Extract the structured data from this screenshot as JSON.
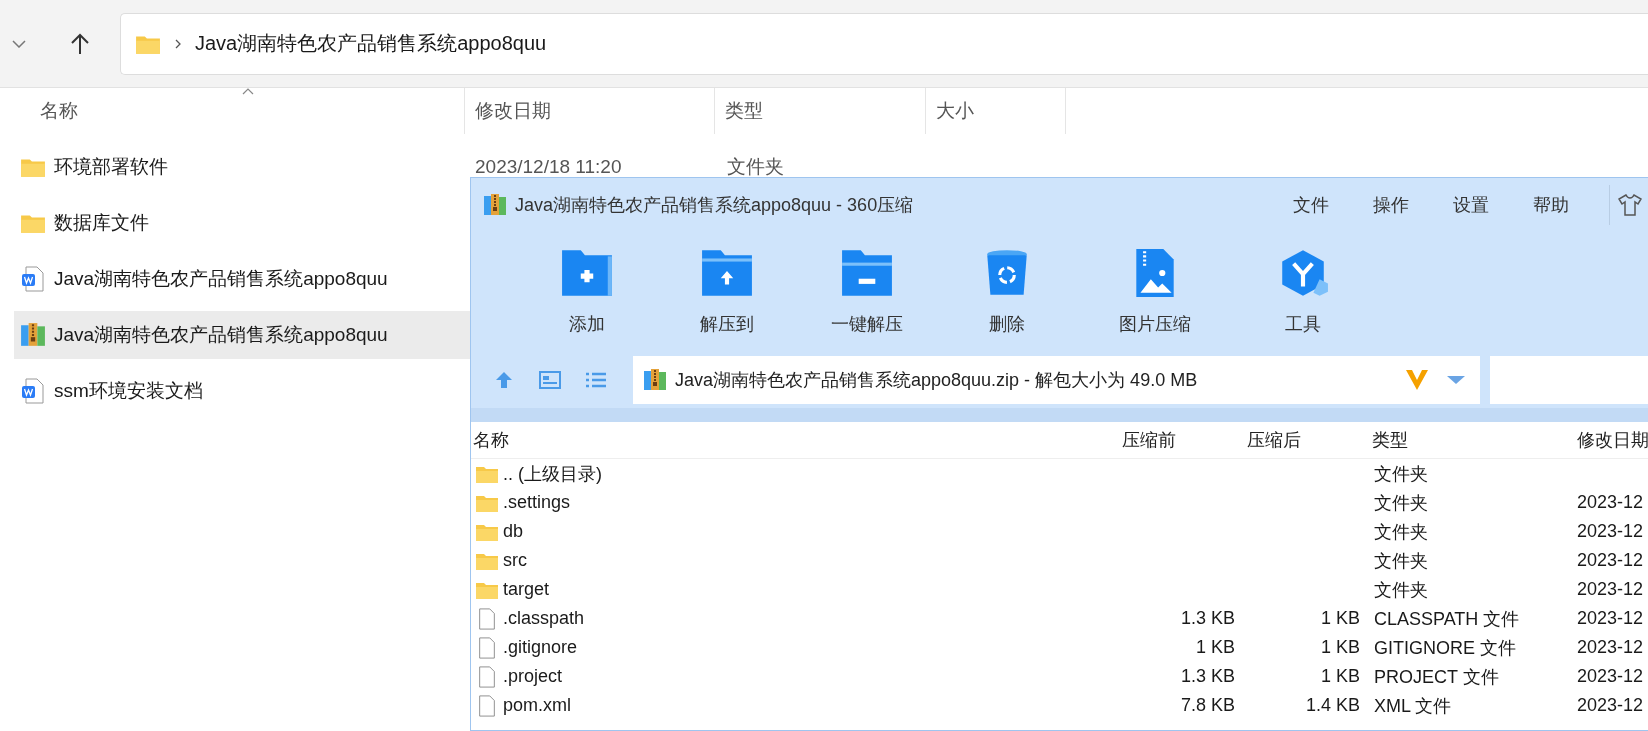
{
  "explorer": {
    "path": "Java湖南特色农产品销售系统appo8quu",
    "columns": [
      "名称",
      "修改日期",
      "类型",
      "大小"
    ],
    "files": [
      {
        "name": "环境部署软件",
        "kind": "folder",
        "date": "2023/12/18 11:20",
        "type": "文件夹",
        "selected": false
      },
      {
        "name": "数据库文件",
        "kind": "folder",
        "selected": false
      },
      {
        "name": "Java湖南特色农产品销售系统appo8quu",
        "kind": "doc",
        "selected": false
      },
      {
        "name": "Java湖南特色农产品销售系统appo8quu",
        "kind": "archive",
        "selected": true
      },
      {
        "name": "ssm环境安装文档",
        "kind": "doc",
        "selected": false
      }
    ]
  },
  "archiver": {
    "title": "Java湖南特色农产品销售系统appo8quu - 360压缩",
    "menu": [
      "文件",
      "操作",
      "设置",
      "帮助"
    ],
    "tools": [
      {
        "label": "添加",
        "kind": "add"
      },
      {
        "label": "解压到",
        "kind": "extract"
      },
      {
        "label": "一键解压",
        "kind": "oneclick"
      },
      {
        "label": "删除",
        "kind": "delete"
      },
      {
        "label": "图片压缩",
        "kind": "image"
      },
      {
        "label": "工具",
        "kind": "tools"
      }
    ],
    "path": "Java湖南特色农产品销售系统appo8quu.zip - 解包大小为 49.0 MB",
    "columns": [
      "名称",
      "压缩前",
      "压缩后",
      "类型",
      "修改日期"
    ],
    "rows": [
      {
        "name": ".. (上级目录)",
        "kind": "folder",
        "type": "文件夹"
      },
      {
        "name": ".settings",
        "kind": "folder",
        "type": "文件夹",
        "date": "2023-12"
      },
      {
        "name": "db",
        "kind": "folder",
        "type": "文件夹",
        "date": "2023-12"
      },
      {
        "name": "src",
        "kind": "folder",
        "type": "文件夹",
        "date": "2023-12"
      },
      {
        "name": "target",
        "kind": "folder",
        "type": "文件夹",
        "date": "2023-12"
      },
      {
        "name": ".classpath",
        "kind": "file",
        "before": "1.3 KB",
        "after": "1 KB",
        "type": "CLASSPATH 文件",
        "date": "2023-12"
      },
      {
        "name": ".gitignore",
        "kind": "file",
        "before": "1 KB",
        "after": "1 KB",
        "type": "GITIGNORE 文件",
        "date": "2023-12"
      },
      {
        "name": ".project",
        "kind": "file",
        "before": "1.3 KB",
        "after": "1 KB",
        "type": "PROJECT 文件",
        "date": "2023-12"
      },
      {
        "name": "pom.xml",
        "kind": "file",
        "before": "7.8 KB",
        "after": "1.4 KB",
        "type": "XML 文件",
        "date": "2023-12"
      }
    ]
  }
}
